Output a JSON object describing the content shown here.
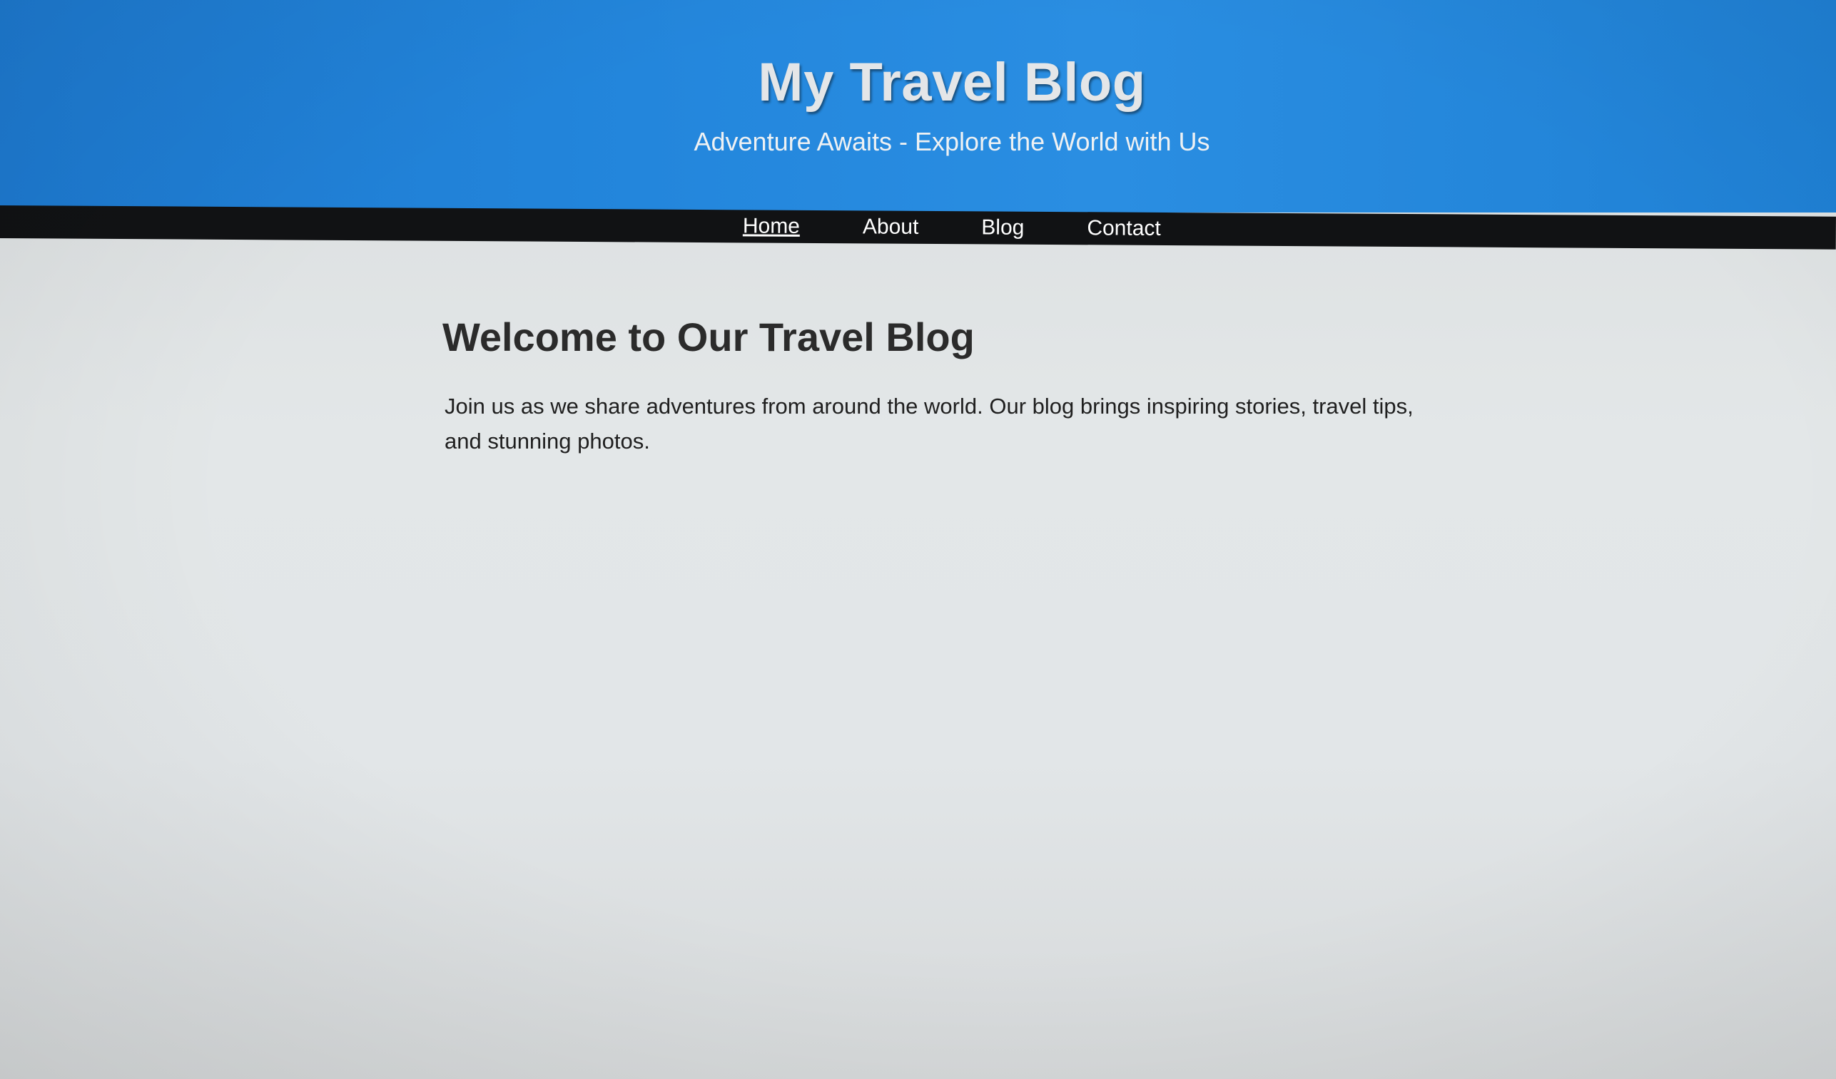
{
  "header": {
    "title": "My Travel Blog",
    "tagline": "Adventure Awaits - Explore the World with Us"
  },
  "nav": {
    "items": [
      {
        "label": "Home",
        "active": true
      },
      {
        "label": "About",
        "active": false
      },
      {
        "label": "Blog",
        "active": false
      },
      {
        "label": "Contact",
        "active": false
      }
    ]
  },
  "main": {
    "heading": "Welcome to Our Travel Blog",
    "intro": "Join us as we share adventures from around the world. Our blog brings inspiring stories, travel tips, and stunning photos."
  },
  "colors": {
    "header_bg": "#2386dc",
    "nav_bg": "#111214",
    "page_bg": "#e2e6e8",
    "title_text": "#e4e6e8",
    "nav_text": "#ffffff",
    "body_text": "#1f1f1f"
  }
}
